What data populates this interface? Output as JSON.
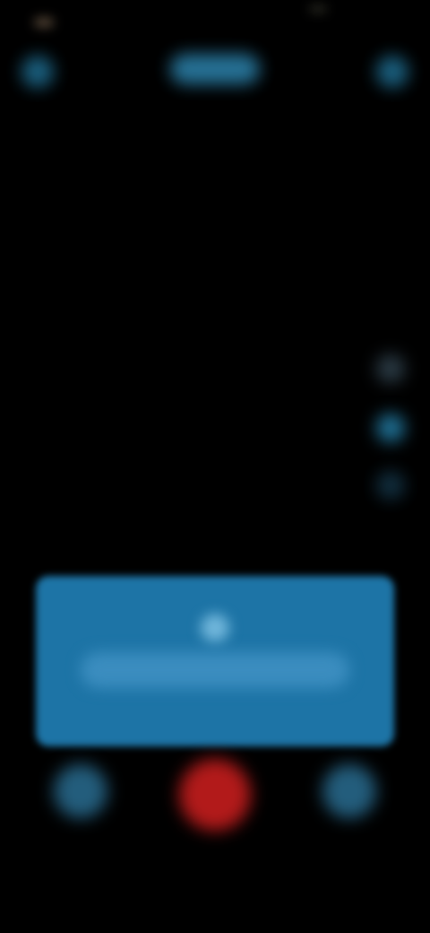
{
  "app": {
    "title": ""
  },
  "status_bar": {},
  "top_bar": {
    "left_icon": "close-icon",
    "center_pill_icon": "pill-toggle",
    "right_icon": "settings-icon"
  },
  "side_controls": {
    "icons": [
      "flash-icon",
      "timer-icon",
      "grid-icon"
    ]
  },
  "prompt_card": {
    "icon": "info-icon",
    "text": ""
  },
  "bottom_controls": {
    "gallery_icon": "gallery-icon",
    "record_icon": "record-icon",
    "flip_icon": "flip-camera-icon",
    "record_color": "#b21a1a"
  },
  "colors": {
    "accent": "#1d74a6",
    "background": "#000000",
    "record": "#b21a1a"
  }
}
